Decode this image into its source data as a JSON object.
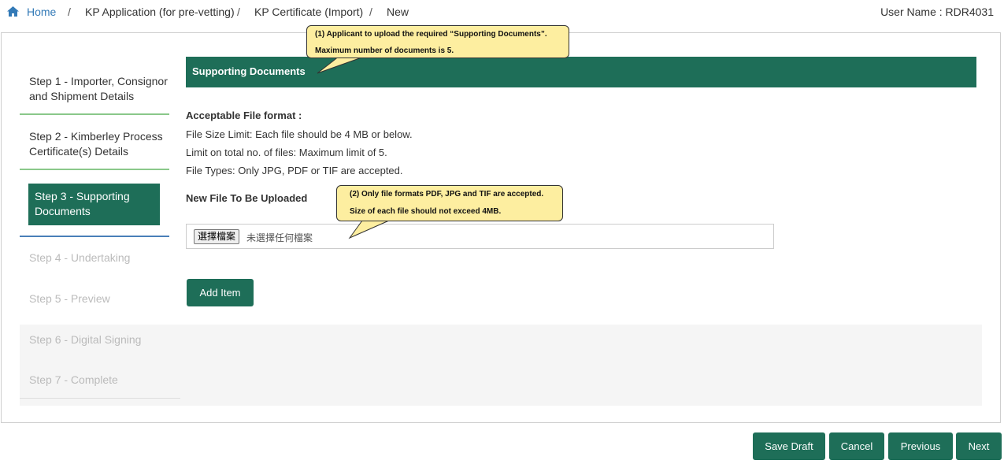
{
  "breadcrumb": {
    "icon": "home-icon",
    "home": "Home",
    "separator": "/",
    "items": [
      "KP Application (for pre-vetting)",
      "KP Certificate (Import)",
      "New"
    ]
  },
  "user": {
    "label": "User Name : RDR4031"
  },
  "steps": [
    {
      "label_line1": "Step 1 - Importer, Consignor",
      "label_line2": "and Shipment Details",
      "state": "done"
    },
    {
      "label_line1": "Step 2 - Kimberley Process",
      "label_line2": "Certificate(s) Details",
      "state": "done"
    },
    {
      "label_line1": "Step 3 - Supporting",
      "label_line2": "Documents",
      "state": "active"
    },
    {
      "label_line1": "Step 4 - Undertaking",
      "state": "future"
    },
    {
      "label_line1": "Step 5 - Preview",
      "state": "future"
    },
    {
      "label_line1": "Step 6 - Digital Signing",
      "state": "future"
    },
    {
      "label_line1": "Step 7 - Complete",
      "state": "future"
    }
  ],
  "section": {
    "title": "Supporting Documents"
  },
  "format": {
    "heading": "Acceptable File format :",
    "size_limit": "File Size Limit: Each file should be 4 MB or below.",
    "count_limit": "Limit on total no. of files: Maximum limit of 5.",
    "types": "File Types: Only JPG, PDF or TIF are accepted."
  },
  "upload": {
    "label": "New File To Be Uploaded",
    "choose_button": "選擇檔案",
    "no_file_text": "未選擇任何檔案",
    "add_button": "Add Item"
  },
  "callouts": {
    "one_line1": "(1) Applicant  to upload  the required  “Supporting  Documents”.",
    "one_line2": "Maximum  number  of documents  is 5.",
    "two_line1": "(2) Only file formats  PDF, JPG and  TIF are accepted.",
    "two_line2": "Size of each file should  not  exceed  4MB."
  },
  "footer": {
    "save_draft": "Save Draft",
    "cancel": "Cancel",
    "previous": "Previous",
    "next": "Next"
  },
  "colors": {
    "primary": "#1e6e58",
    "link": "#337ab7",
    "callout": "#fdeea0",
    "completed_line": "#8ac88a",
    "active_line": "#4a7fb8"
  }
}
